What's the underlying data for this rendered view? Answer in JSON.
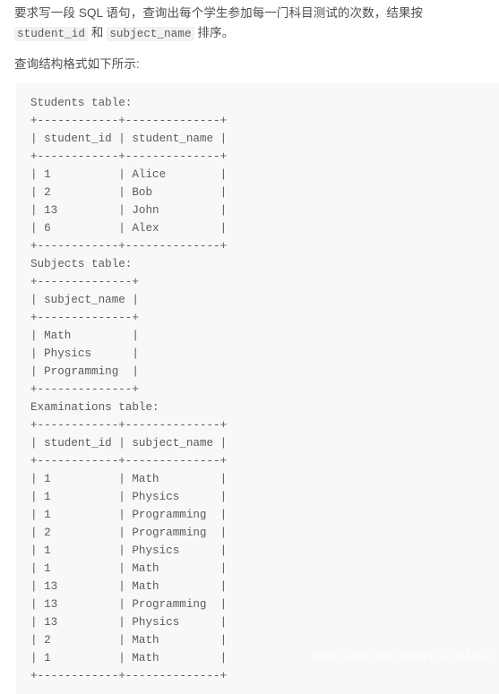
{
  "prose": {
    "intro_before_code1": "要求写一段 SQL 语句，查询出每个学生参加每一门科目测试的次数，结果按 ",
    "inline_code_1": "student_id",
    "intro_between": " 和",
    "inline_code_2": "subject_name",
    "intro_after_code2": " 排序。",
    "lead": "查询结构格式如下所示:"
  },
  "code_block": {
    "lines": [
      "Students table:",
      "+------------+--------------+",
      "| student_id | student_name |",
      "+------------+--------------+",
      "| 1          | Alice        |",
      "| 2          | Bob          |",
      "| 13         | John         |",
      "| 6          | Alex         |",
      "+------------+--------------+",
      "Subjects table:",
      "+--------------+",
      "| subject_name |",
      "+--------------+",
      "| Math         |",
      "| Physics      |",
      "| Programming  |",
      "+--------------+",
      "Examinations table:",
      "+------------+--------------+",
      "| student_id | subject_name |",
      "+------------+--------------+",
      "| 1          | Math         |",
      "| 1          | Physics      |",
      "| 1          | Programming  |",
      "| 2          | Programming  |",
      "| 1          | Physics      |",
      "| 1          | Math         |",
      "| 13         | Math         |",
      "| 13         | Programming  |",
      "| 13         | Physics      |",
      "| 2          | Math         |",
      "| 1          | Math         |",
      "+------------+--------------+"
    ],
    "tables": {
      "students": {
        "name": "Students table:",
        "columns": [
          "student_id",
          "student_name"
        ],
        "rows": [
          [
            "1",
            "Alice"
          ],
          [
            "2",
            "Bob"
          ],
          [
            "13",
            "John"
          ],
          [
            "6",
            "Alex"
          ]
        ]
      },
      "subjects": {
        "name": "Subjects table:",
        "columns": [
          "subject_name"
        ],
        "rows": [
          [
            "Math"
          ],
          [
            "Physics"
          ],
          [
            "Programming"
          ]
        ]
      },
      "examinations": {
        "name": "Examinations table:",
        "columns": [
          "student_id",
          "subject_name"
        ],
        "rows": [
          [
            "1",
            "Math"
          ],
          [
            "1",
            "Physics"
          ],
          [
            "1",
            "Programming"
          ],
          [
            "2",
            "Programming"
          ],
          [
            "1",
            "Physics"
          ],
          [
            "1",
            "Math"
          ],
          [
            "13",
            "Math"
          ],
          [
            "13",
            "Programming"
          ],
          [
            "13",
            "Physics"
          ],
          [
            "2",
            "Math"
          ],
          [
            "1",
            "Math"
          ]
        ]
      }
    }
  },
  "watermark": {
    "text": "https://blog.csdn.net/qq_42053453"
  },
  "colors": {
    "page_background": "#ffffff",
    "code_background": "#f7f8fa",
    "inline_code_background": "#f2f2f5",
    "body_text": "#4f4f4f",
    "code_text": "#5a5a5a",
    "watermark_text": "#ffffff"
  }
}
